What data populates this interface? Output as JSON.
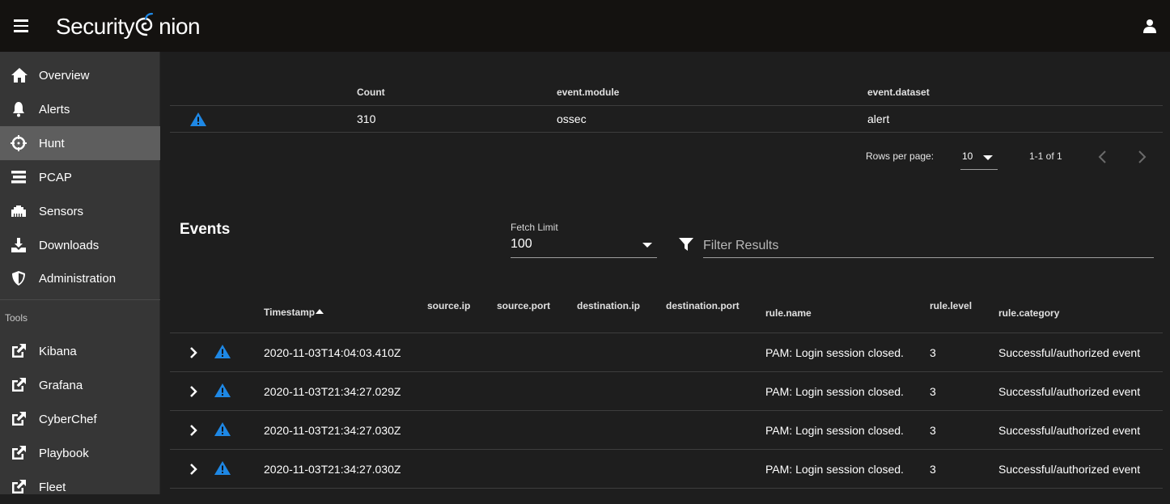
{
  "app": {
    "logo_text_1": "Security",
    "logo_text_2": "nion"
  },
  "icons": {
    "menu": "menu-icon",
    "user": "user-icon",
    "alert": "alert-triangle-icon",
    "filter": "filter-icon",
    "expand": "chevron-right-icon"
  },
  "colors": {
    "accent": "#1e88e5",
    "topbar": "#141210",
    "sidebar": "#363636",
    "active_nav": "#5e5e5e",
    "background": "#1e1e1e"
  },
  "sidebar": {
    "items": [
      {
        "label": "Overview",
        "icon": "home-icon"
      },
      {
        "label": "Alerts",
        "icon": "bell-icon"
      },
      {
        "label": "Hunt",
        "icon": "crosshairs-icon",
        "active": true
      },
      {
        "label": "PCAP",
        "icon": "stream-icon"
      },
      {
        "label": "Sensors",
        "icon": "ethernet-icon"
      },
      {
        "label": "Downloads",
        "icon": "download-icon"
      },
      {
        "label": "Administration",
        "icon": "shield-icon"
      }
    ],
    "section_label": "Tools",
    "tools": [
      {
        "label": "Kibana",
        "icon": "external-link-icon"
      },
      {
        "label": "Grafana",
        "icon": "external-link-icon"
      },
      {
        "label": "CyberChef",
        "icon": "external-link-icon"
      },
      {
        "label": "Playbook",
        "icon": "external-link-icon"
      },
      {
        "label": "Fleet",
        "icon": "external-link-icon"
      }
    ]
  },
  "aggregation": {
    "headers": {
      "count": "Count",
      "module": "event.module",
      "dataset": "event.dataset"
    },
    "rows": [
      {
        "count": "310",
        "module": "ossec",
        "dataset": "alert"
      }
    ],
    "pagination": {
      "rows_per_page_label": "Rows per page:",
      "rows_per_page_value": "10",
      "range": "1-1 of 1"
    }
  },
  "events": {
    "title": "Events",
    "fetch_limit_label": "Fetch Limit",
    "fetch_limit_value": "100",
    "filter_placeholder": "Filter Results",
    "headers": {
      "timestamp": "Timestamp",
      "source_ip": "source.ip",
      "source_port": "source.port",
      "destination_ip": "destination.ip",
      "destination_port": "destination.port",
      "rule_name": "rule.name",
      "rule_level": "rule.level",
      "rule_category": "rule.category"
    },
    "rows": [
      {
        "timestamp": "2020-11-03T14:04:03.410Z",
        "rule_name": "PAM: Login session closed.",
        "rule_level": "3",
        "rule_category": "Successful/authorized event"
      },
      {
        "timestamp": "2020-11-03T21:34:27.029Z",
        "rule_name": "PAM: Login session closed.",
        "rule_level": "3",
        "rule_category": "Successful/authorized event"
      },
      {
        "timestamp": "2020-11-03T21:34:27.030Z",
        "rule_name": "PAM: Login session closed.",
        "rule_level": "3",
        "rule_category": "Successful/authorized event"
      },
      {
        "timestamp": "2020-11-03T21:34:27.030Z",
        "rule_name": "PAM: Login session closed.",
        "rule_level": "3",
        "rule_category": "Successful/authorized event"
      }
    ]
  }
}
